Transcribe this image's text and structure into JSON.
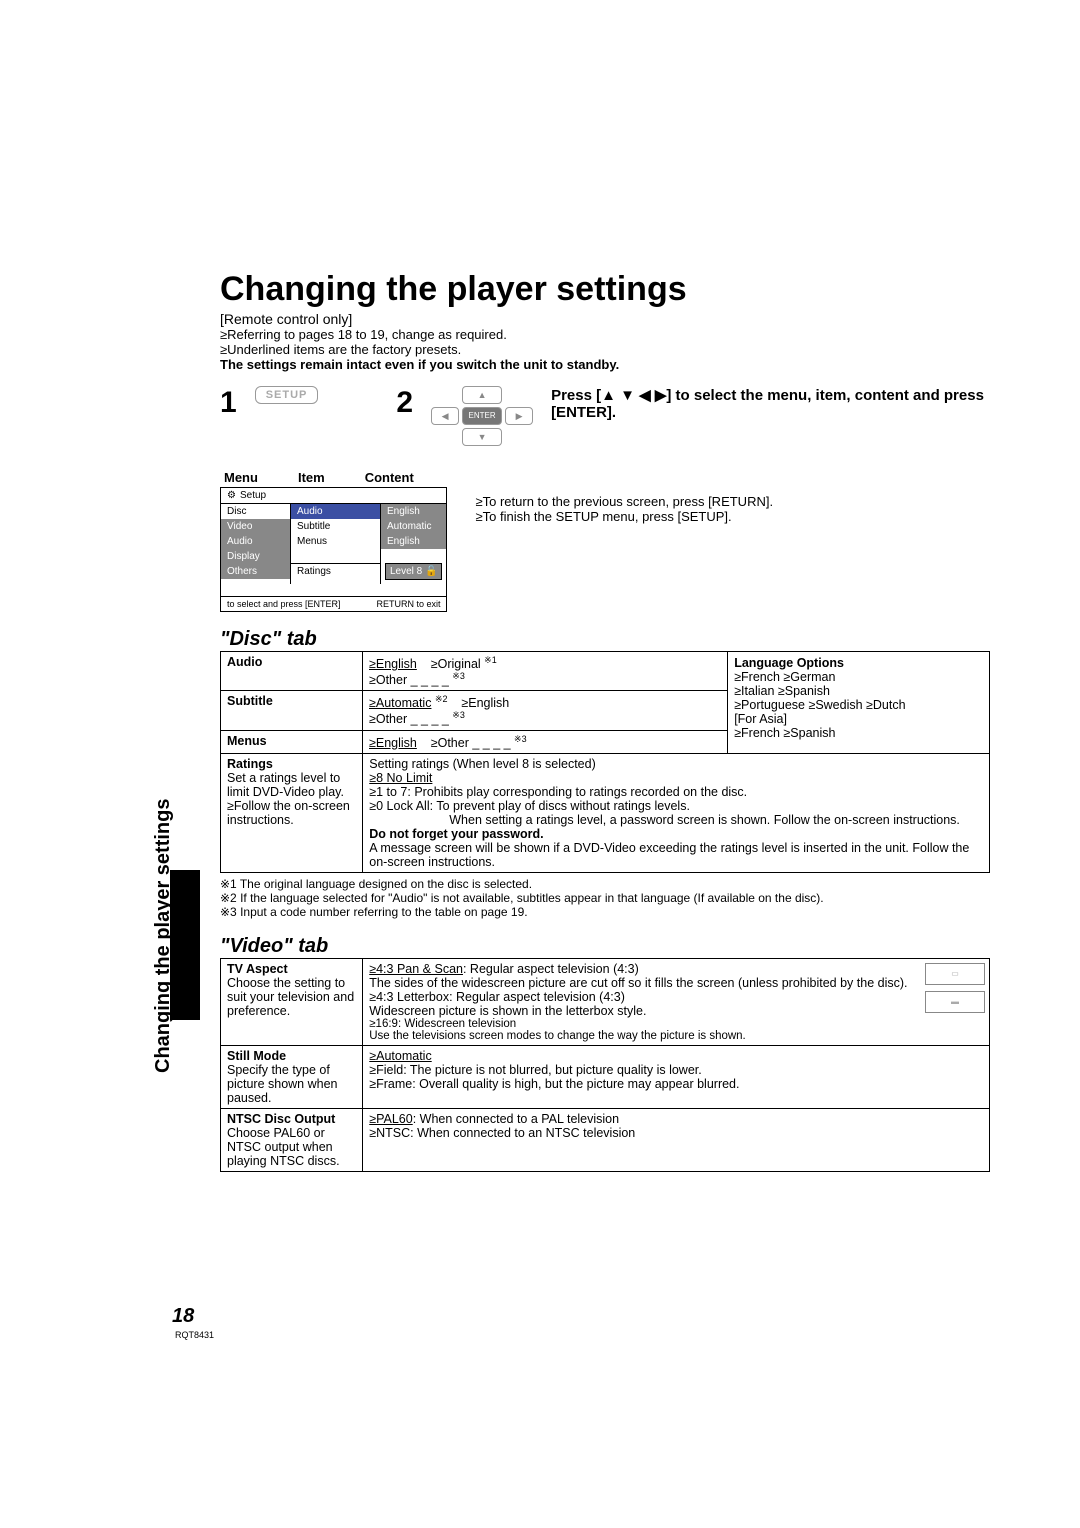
{
  "header": {
    "title": "Changing the player settings",
    "remote": "[Remote control only]",
    "line1": "≥Referring to pages 18 to 19, change as required.",
    "line2": "≥Underlined items are the factory presets.",
    "line3": "The settings remain intact even if you switch the unit to standby."
  },
  "step1": {
    "num": "1",
    "btn": "SETUP"
  },
  "step2": {
    "num": "2",
    "nav": {
      "up": "▲",
      "down": "▼",
      "left": "◀",
      "right": "▶",
      "enter": "ENTER"
    },
    "text_a": "Press [▲ ▼ ◀ ▶] to select the menu, item, content and press [ENTER]."
  },
  "osd": {
    "h_menu": "Menu",
    "h_item": "Item",
    "h_content": "Content",
    "title": "Setup",
    "menus": [
      "Disc",
      "Video",
      "Audio",
      "Display",
      "Others"
    ],
    "items": [
      "Audio",
      "Subtitle",
      "Menus"
    ],
    "contents": [
      "English",
      "Automatic",
      "English"
    ],
    "ratings_label": "Ratings",
    "ratings_val": "Level 8 🔓",
    "footer_left": "to select and press [ENTER]",
    "footer_right": "RETURN to exit"
  },
  "returns": {
    "l1": "≥To return to the previous screen, press [RETURN].",
    "l2": "≥To finish the SETUP menu, press [SETUP]."
  },
  "disc_tab": {
    "title": "\"Disc\" tab",
    "rows": {
      "audio": {
        "h": "Audio",
        "c": "≥English    ≥Original ※1\n≥Other _ _ _ _ ※3"
      },
      "subtitle": {
        "h": "Subtitle",
        "c": "≥Automatic ※2    ≥English\n≥Other _ _ _ _ ※3"
      },
      "menus": {
        "h": "Menus",
        "c": "≥English    ≥Other _ _ _ _ ※3"
      },
      "ratings": {
        "h": "Ratings",
        "h_sub": "Set a ratings level to limit DVD-Video play.\n≥Follow the on-screen instructions.",
        "c1": "Setting ratings (When level 8 is selected)",
        "c2": "≥8 No Limit",
        "c3": "≥1 to 7: Prohibits play corresponding to ratings recorded on the disc.",
        "c4": "≥0 Lock All: To prevent play of discs without ratings levels.",
        "c5": "When setting a ratings level, a password screen is shown. Follow the on-screen instructions.",
        "c6": "Do not forget your password.",
        "c7": "A message screen will be shown if a DVD-Video exceeding the ratings level is inserted in the unit. Follow the on-screen instructions."
      }
    },
    "lang": {
      "title": "Language Options",
      "row1": "≥French    ≥German",
      "row2": "≥Italian    ≥Spanish",
      "row3": "≥Portuguese  ≥Swedish   ≥Dutch",
      "asia": "[For Asia]",
      "row4": "≥French    ≥Spanish"
    },
    "fn1": "※1 The original language designed on the disc is selected.",
    "fn2": "※2 If the language selected for \"Audio\" is not available, subtitles appear in that language (If available on the disc).",
    "fn3": "※3 Input a code number referring to the table on page 19."
  },
  "video_tab": {
    "title": "\"Video\" tab",
    "rows": {
      "aspect": {
        "h": "TV Aspect",
        "h_sub": "Choose the setting to suit your television and preference.",
        "c1": "≥4:3 Pan & Scan: Regular aspect television (4:3)\nThe sides of the widescreen picture are cut off so it fills the screen (unless prohibited by the disc).",
        "c2": "≥4:3 Letterbox: Regular aspect television (4:3)\nWidescreen picture is shown in the letterbox style.",
        "c3": "≥16:9: Widescreen television\nUse the televisions screen modes to change the way the picture is shown."
      },
      "still": {
        "h": "Still Mode",
        "h_sub": "Specify the type of picture shown when paused.",
        "c1": "≥Automatic",
        "c2": "≥Field: The picture is not blurred, but picture quality is lower.",
        "c3": "≥Frame: Overall quality is high, but the picture may appear blurred."
      },
      "ntsc": {
        "h": "NTSC Disc Output",
        "h_sub": "Choose PAL60 or NTSC output when playing NTSC discs.",
        "c1": "≥PAL60: When connected to a PAL television",
        "c2": "≥NTSC: When connected to an NTSC television"
      }
    }
  },
  "side": {
    "text": "Changing the player settings",
    "pagenum": "18",
    "code": "RQT8431"
  }
}
